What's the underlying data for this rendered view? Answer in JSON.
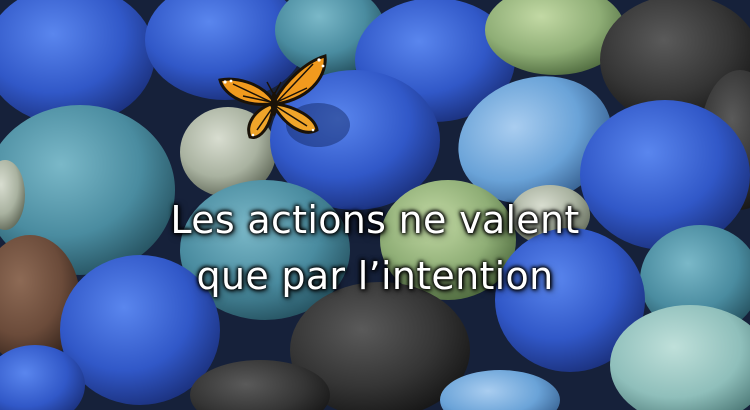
{
  "caption": {
    "line1": "Les actions ne valent",
    "line2": "que par l’intention"
  },
  "colors": {
    "background": "#1c2a44",
    "pebble_royal_blue": "#3b5fd0",
    "pebble_sky_blue": "#6aa3d8",
    "pebble_teal": "#4f95a8",
    "pebble_green": "#8fae76",
    "pebble_dark": "#3a3a3a",
    "pebble_brown": "#6b4b3a",
    "butterfly_orange": "#f19a1e",
    "caption_text": "#ffffff"
  },
  "icons": {
    "butterfly": "monarch-butterfly-icon"
  }
}
